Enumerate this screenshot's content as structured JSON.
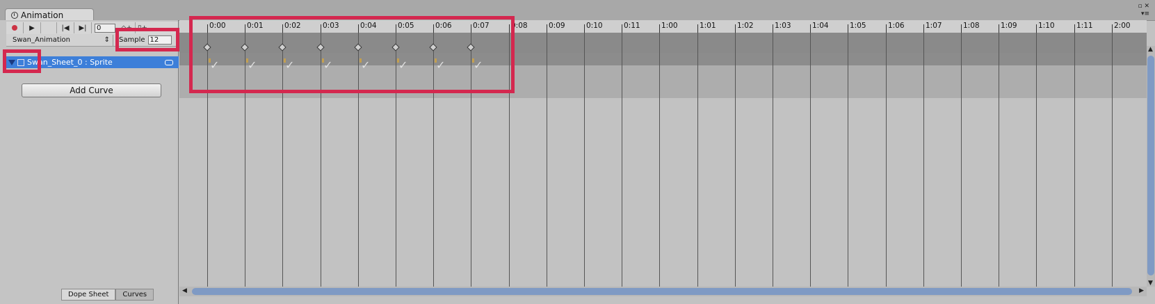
{
  "window": {
    "tab_title": "Animation",
    "controls": "▫ ✕",
    "menu_glyph": "▾≡"
  },
  "toolbar": {
    "frame_value": "0",
    "record_icon": "record-icon",
    "play_icon": "play-icon",
    "prev_key_icon": "prev-key-icon",
    "next_key_icon": "next-key-icon",
    "add_key_icon": "add-keyframe-icon",
    "add_event_icon": "add-event-icon"
  },
  "clip": {
    "name": "Swan_Animation",
    "sample_label": "Sample",
    "sample_value": "12"
  },
  "property": {
    "label": "Swan_Sheet_0 : Sprite"
  },
  "add_curve_label": "Add Curve",
  "bottom_tabs": [
    "Dope Sheet",
    "Curves"
  ],
  "timeline": {
    "labels": [
      "0:00",
      "0:01",
      "0:02",
      "0:03",
      "0:04",
      "0:05",
      "0:06",
      "0:07",
      "0:08",
      "0:09",
      "0:10",
      "0:11",
      "1:00",
      "1:01",
      "1:02",
      "1:03",
      "1:04",
      "1:05",
      "1:06",
      "1:07",
      "1:08",
      "1:09",
      "1:10",
      "1:11",
      "2:00"
    ],
    "keyframe_count": 8,
    "sprite_glyph": "✓"
  },
  "highlight_color": "#d4284f"
}
